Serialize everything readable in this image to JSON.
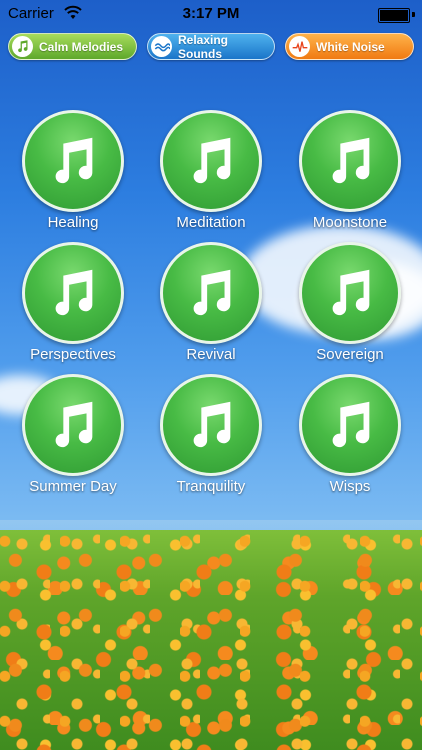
{
  "status_bar": {
    "carrier": "Carrier",
    "time": "3:17 PM"
  },
  "tabs": [
    {
      "label": "Calm Melodies",
      "icon": "music-note-icon",
      "color": "#5ea82b"
    },
    {
      "label": "Relaxing Sounds",
      "icon": "wave-icon",
      "color": "#1a75c9"
    },
    {
      "label": "White Noise",
      "icon": "pulse-icon",
      "color": "#f07a12"
    }
  ],
  "melodies": [
    {
      "label": "Healing"
    },
    {
      "label": "Meditation"
    },
    {
      "label": "Moonstone"
    },
    {
      "label": "Perspectives"
    },
    {
      "label": "Revival"
    },
    {
      "label": "Sovereign"
    },
    {
      "label": "Summer Day"
    },
    {
      "label": "Tranquility"
    },
    {
      "label": "Wisps"
    }
  ],
  "accent_green": "#48bb45"
}
